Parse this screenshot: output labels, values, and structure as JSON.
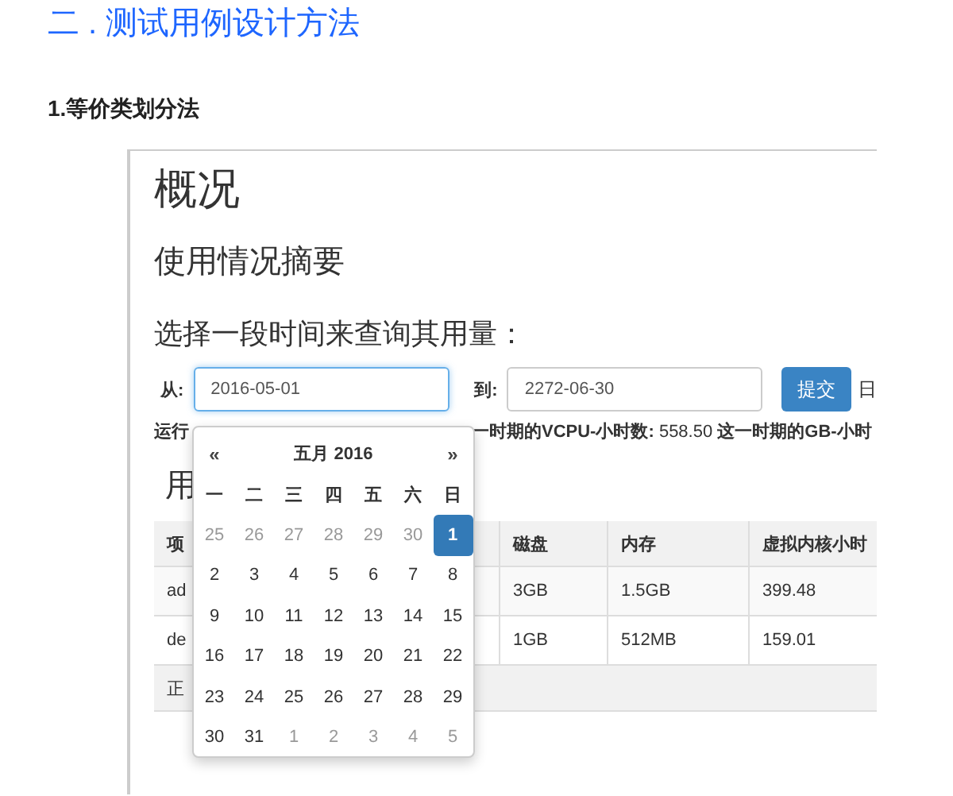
{
  "heading": "二 . 测试用例设计方法",
  "subheading": "1.等价类划分法",
  "screenshot": {
    "title": "概况",
    "section": "使用情况摘要",
    "prompt": "选择一段时间来查询其用量：",
    "form": {
      "from_label": "从:",
      "from_value": "2016-05-01",
      "from_focused": true,
      "to_label": "到:",
      "to_value": "2272-06-30",
      "submit": "提交",
      "trailing": "日"
    },
    "summary": [
      "运行",
      "**一时期的VCPU-小时数:** 558.50 **这一时期的GB-小时**"
    ],
    "usage_heading": "用",
    "table": {
      "columns": [
        "项",
        "磁盘",
        "内存",
        "虚拟内核小时"
      ],
      "rows": [
        [
          "ad",
          "3GB",
          "1.5GB",
          "399.48"
        ],
        [
          "de",
          "1GB",
          "512MB",
          "159.01"
        ]
      ],
      "footer": "正"
    },
    "datepicker": {
      "prev": "«",
      "title": "五月 2016",
      "next": "»",
      "weekdays": [
        "一",
        "二",
        "三",
        "四",
        "五",
        "六",
        "日"
      ],
      "weeks": [
        [
          {
            "day": "25",
            "muted": true,
            "selected": false
          },
          {
            "day": "26",
            "muted": true,
            "selected": false
          },
          {
            "day": "27",
            "muted": true,
            "selected": false
          },
          {
            "day": "28",
            "muted": true,
            "selected": false
          },
          {
            "day": "29",
            "muted": true,
            "selected": false
          },
          {
            "day": "30",
            "muted": true,
            "selected": false
          },
          {
            "day": "1",
            "muted": false,
            "selected": true
          }
        ],
        [
          {
            "day": "2",
            "muted": false,
            "selected": false
          },
          {
            "day": "3",
            "muted": false,
            "selected": false
          },
          {
            "day": "4",
            "muted": false,
            "selected": false
          },
          {
            "day": "5",
            "muted": false,
            "selected": false
          },
          {
            "day": "6",
            "muted": false,
            "selected": false
          },
          {
            "day": "7",
            "muted": false,
            "selected": false
          },
          {
            "day": "8",
            "muted": false,
            "selected": false
          }
        ],
        [
          {
            "day": "9",
            "muted": false,
            "selected": false
          },
          {
            "day": "10",
            "muted": false,
            "selected": false
          },
          {
            "day": "11",
            "muted": false,
            "selected": false
          },
          {
            "day": "12",
            "muted": false,
            "selected": false
          },
          {
            "day": "13",
            "muted": false,
            "selected": false
          },
          {
            "day": "14",
            "muted": false,
            "selected": false
          },
          {
            "day": "15",
            "muted": false,
            "selected": false
          }
        ],
        [
          {
            "day": "16",
            "muted": false,
            "selected": false
          },
          {
            "day": "17",
            "muted": false,
            "selected": false
          },
          {
            "day": "18",
            "muted": false,
            "selected": false
          },
          {
            "day": "19",
            "muted": false,
            "selected": false
          },
          {
            "day": "20",
            "muted": false,
            "selected": false
          },
          {
            "day": "21",
            "muted": false,
            "selected": false
          },
          {
            "day": "22",
            "muted": false,
            "selected": false
          }
        ],
        [
          {
            "day": "23",
            "muted": false,
            "selected": false
          },
          {
            "day": "24",
            "muted": false,
            "selected": false
          },
          {
            "day": "25",
            "muted": false,
            "selected": false
          },
          {
            "day": "26",
            "muted": false,
            "selected": false
          },
          {
            "day": "27",
            "muted": false,
            "selected": false
          },
          {
            "day": "28",
            "muted": false,
            "selected": false
          },
          {
            "day": "29",
            "muted": false,
            "selected": false
          }
        ],
        [
          {
            "day": "30",
            "muted": false,
            "selected": false
          },
          {
            "day": "31",
            "muted": false,
            "selected": false
          },
          {
            "day": "1",
            "muted": true,
            "selected": false
          },
          {
            "day": "2",
            "muted": true,
            "selected": false
          },
          {
            "day": "3",
            "muted": true,
            "selected": false
          },
          {
            "day": "4",
            "muted": true,
            "selected": false
          },
          {
            "day": "5",
            "muted": true,
            "selected": false
          }
        ]
      ]
    }
  }
}
